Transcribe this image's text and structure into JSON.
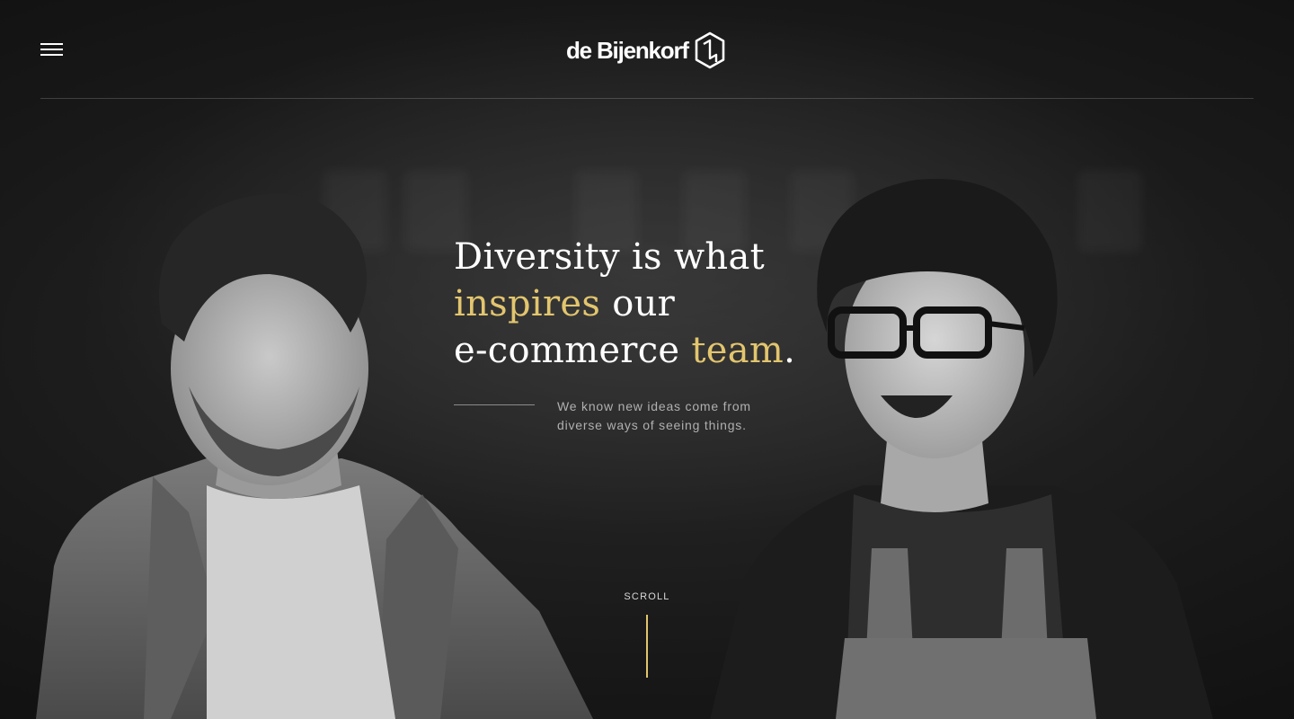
{
  "header": {
    "logo_text": "de Bijenkorf",
    "menu_icon": "hamburger-menu-icon",
    "logo_icon": "bijenkorf-hexagon-logo-icon"
  },
  "hero": {
    "headline": {
      "line1": "Diversity is what",
      "line2_accent": "inspires",
      "line2_rest": " our",
      "line3_start": "e-commerce ",
      "line3_accent": "team",
      "line3_end": "."
    },
    "subtext_line1": "We know new ideas come from",
    "subtext_line2": "diverse ways of seeing things."
  },
  "scroll": {
    "label": "SCROLL"
  },
  "colors": {
    "background": "#141414",
    "accent": "#e2c56e",
    "text": "#ffffff",
    "muted": "#b0b0b0"
  }
}
